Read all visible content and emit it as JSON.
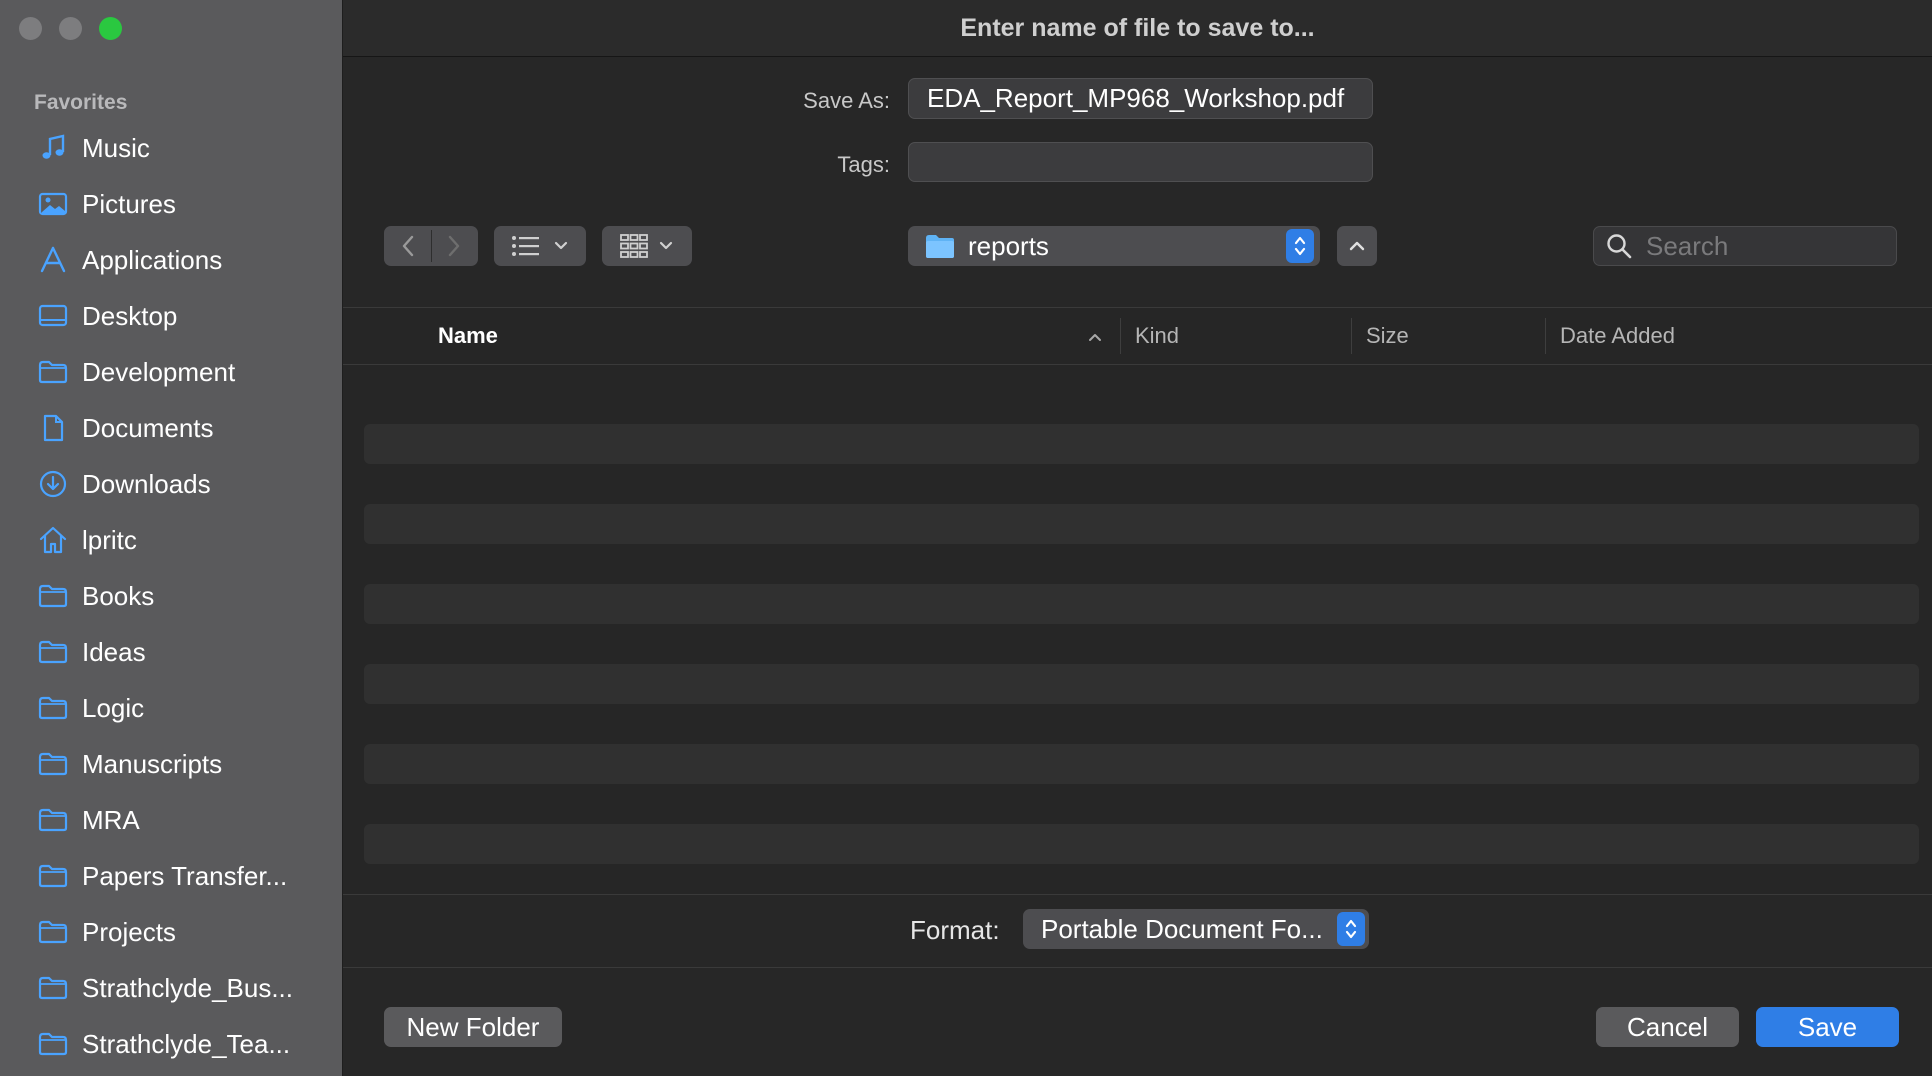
{
  "window": {
    "title": "Enter name of file to save to..."
  },
  "sidebar": {
    "section_label": "Favorites",
    "items": [
      {
        "label": "Music",
        "icon": "music-note-icon"
      },
      {
        "label": "Pictures",
        "icon": "photo-icon"
      },
      {
        "label": "Applications",
        "icon": "applications-icon"
      },
      {
        "label": "Desktop",
        "icon": "desktop-icon"
      },
      {
        "label": "Development",
        "icon": "folder-icon"
      },
      {
        "label": "Documents",
        "icon": "document-icon"
      },
      {
        "label": "Downloads",
        "icon": "download-icon"
      },
      {
        "label": "lpritc",
        "icon": "home-icon"
      },
      {
        "label": "Books",
        "icon": "folder-icon"
      },
      {
        "label": "Ideas",
        "icon": "folder-icon"
      },
      {
        "label": "Logic",
        "icon": "folder-icon"
      },
      {
        "label": "Manuscripts",
        "icon": "folder-icon"
      },
      {
        "label": "MRA",
        "icon": "folder-icon"
      },
      {
        "label": "Papers Transfer...",
        "icon": "folder-icon"
      },
      {
        "label": "Projects",
        "icon": "folder-icon"
      },
      {
        "label": "Strathclyde_Bus...",
        "icon": "folder-icon"
      },
      {
        "label": "Strathclyde_Tea...",
        "icon": "folder-icon"
      }
    ]
  },
  "form": {
    "save_as_label": "Save As:",
    "save_as_value": "EDA_Report_MP968_Workshop.pdf",
    "tags_label": "Tags:",
    "tags_value": ""
  },
  "toolbar": {
    "current_folder": "reports",
    "search_placeholder": "Search"
  },
  "browser": {
    "columns": [
      "Name",
      "Kind",
      "Size",
      "Date Added"
    ],
    "sorted_column": "Name",
    "sort_direction": "ascending",
    "rows": []
  },
  "format": {
    "label": "Format:",
    "value": "Portable Document Fo..."
  },
  "buttons": {
    "new_folder": "New Folder",
    "cancel": "Cancel",
    "save": "Save"
  },
  "colors": {
    "accent": "#2f7ee6",
    "sidebar_bg": "#5a5a5c",
    "icon_blue": "#4aa3ff",
    "maximize_green": "#2ac840"
  }
}
